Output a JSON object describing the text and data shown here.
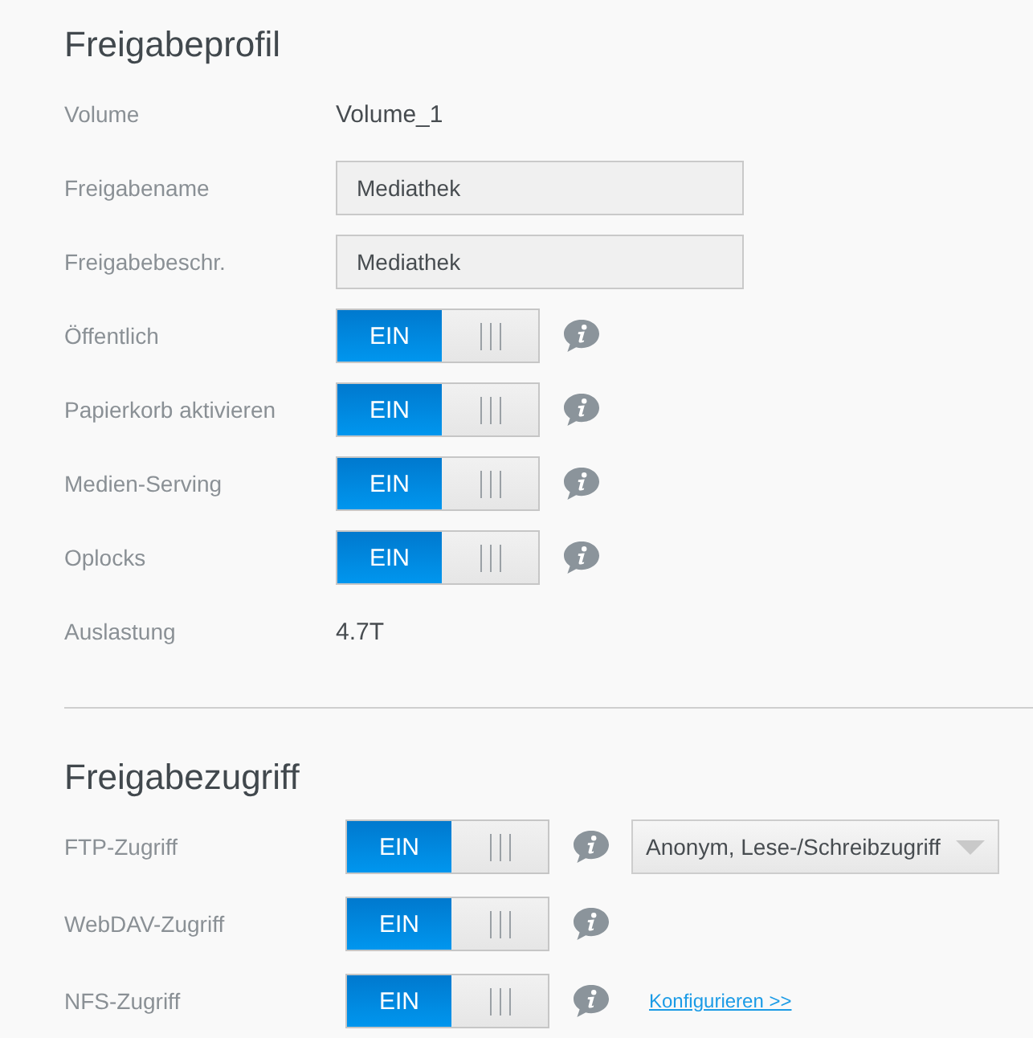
{
  "sections": [
    {
      "title": "Freigabeprofil",
      "rows": [
        {
          "kind": "text",
          "label": "Volume",
          "value": "Volume_1"
        },
        {
          "kind": "input",
          "label": "Freigabename",
          "value": "Mediathek"
        },
        {
          "kind": "input",
          "label": "Freigabebeschr.",
          "value": "Mediathek"
        },
        {
          "kind": "toggle",
          "label": "Öffentlich",
          "toggle": {
            "on": true,
            "label": "EIN"
          },
          "info": true
        },
        {
          "kind": "toggle",
          "label": "Papierkorb aktivieren",
          "toggle": {
            "on": true,
            "label": "EIN"
          },
          "info": true
        },
        {
          "kind": "toggle",
          "label": "Medien-Serving",
          "toggle": {
            "on": true,
            "label": "EIN"
          },
          "info": true
        },
        {
          "kind": "toggle",
          "label": "Oplocks",
          "toggle": {
            "on": true,
            "label": "EIN"
          },
          "info": true
        },
        {
          "kind": "text",
          "label": "Auslastung",
          "value": "4.7T"
        }
      ]
    },
    {
      "title": "Freigabezugriff",
      "rows": [
        {
          "kind": "toggle",
          "label": "FTP-Zugriff",
          "toggle": {
            "on": true,
            "label": "EIN"
          },
          "info": true,
          "dropdown": {
            "value": "Anonym, Lese-/Schreibzugriff"
          }
        },
        {
          "kind": "toggle",
          "label": "WebDAV-Zugriff",
          "toggle": {
            "on": true,
            "label": "EIN"
          },
          "info": true
        },
        {
          "kind": "toggle",
          "label": "NFS-Zugriff",
          "toggle": {
            "on": true,
            "label": "EIN"
          },
          "info": true,
          "link": "Konfigurieren >>"
        }
      ]
    }
  ]
}
